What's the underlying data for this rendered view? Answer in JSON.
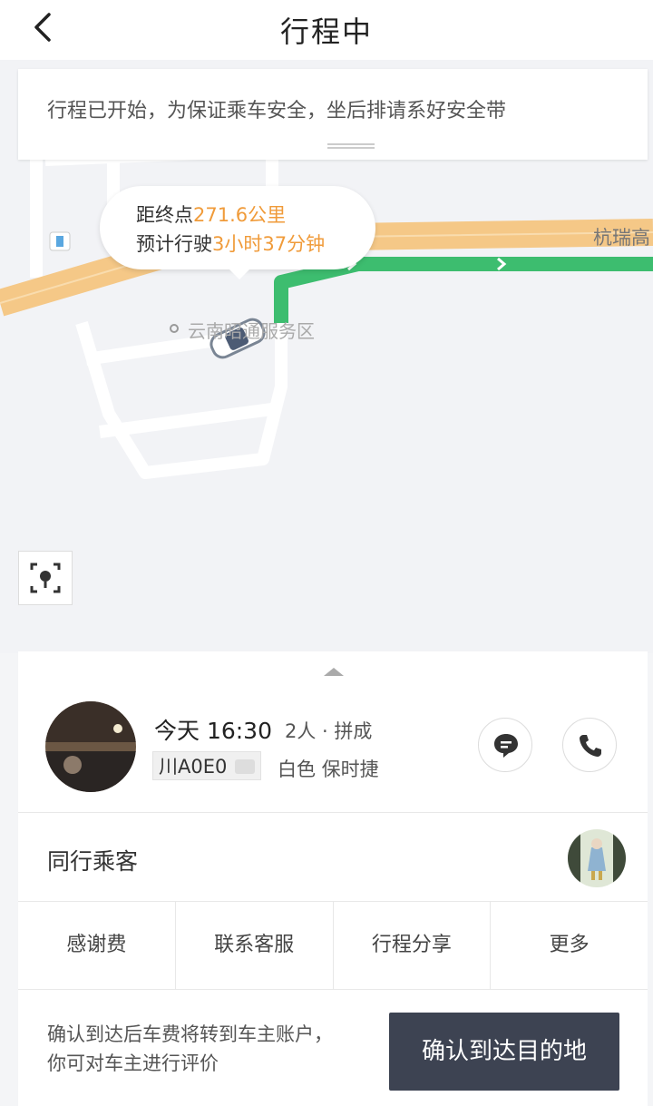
{
  "header": {
    "title": "行程中"
  },
  "notice": {
    "text": "行程已开始，为保证乘车安全，坐后排请系好安全带"
  },
  "map": {
    "road_label": "杭瑞高",
    "poi_label": "云南昭通服务区",
    "bubble": {
      "distance_prefix": "距终点",
      "distance_value": "271.6公里",
      "eta_prefix": "预计行驶",
      "eta_value": "3小时37分钟"
    }
  },
  "trip": {
    "time": "今天 16:30",
    "meta": "2人 · 拼成",
    "plate": "川A0E0",
    "car": "白色 保时捷"
  },
  "fellow": {
    "label": "同行乘客"
  },
  "actions": [
    "感谢费",
    "联系客服",
    "行程分享",
    "更多"
  ],
  "footer": {
    "text": "确认到达后车费将转到车主账户，你可对车主进行评价",
    "confirm_label": "确认到达目的地"
  },
  "colors": {
    "accent": "#f09b3a",
    "route": "#3dbd6f",
    "highway": "#f5c887",
    "button": "#3d4352"
  }
}
